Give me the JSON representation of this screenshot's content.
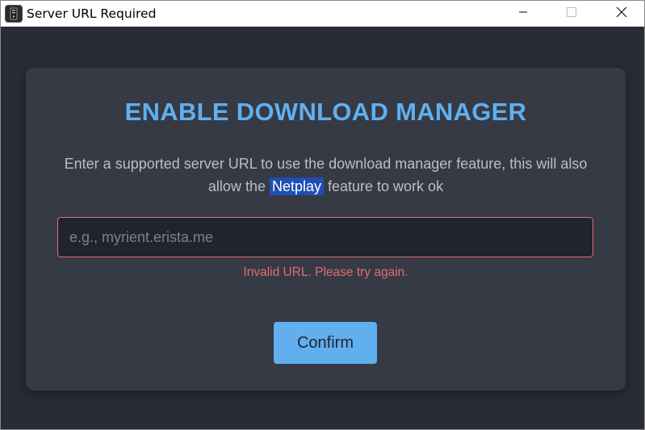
{
  "window": {
    "title": "Server URL Required"
  },
  "titlebar": {
    "icons": {
      "app": "app-icon",
      "minimize": "minimize-icon",
      "maximize": "maximize-icon",
      "close": "close-icon"
    }
  },
  "dialog": {
    "heading": "ENABLE DOWNLOAD MANAGER",
    "description_before": "Enter a supported server URL to use the download manager feature, this will also allow the ",
    "description_highlight": "Netplay",
    "description_after": " feature to work ok",
    "input": {
      "value": "",
      "placeholder": "e.g., myrient.erista.me"
    },
    "error_message": "Invalid URL. Please try again.",
    "confirm_label": "Confirm"
  },
  "colors": {
    "background": "#282c34",
    "card": "#353a45",
    "accent": "#61afef",
    "error": "#e06c75",
    "highlight": "#1f4fb4"
  }
}
